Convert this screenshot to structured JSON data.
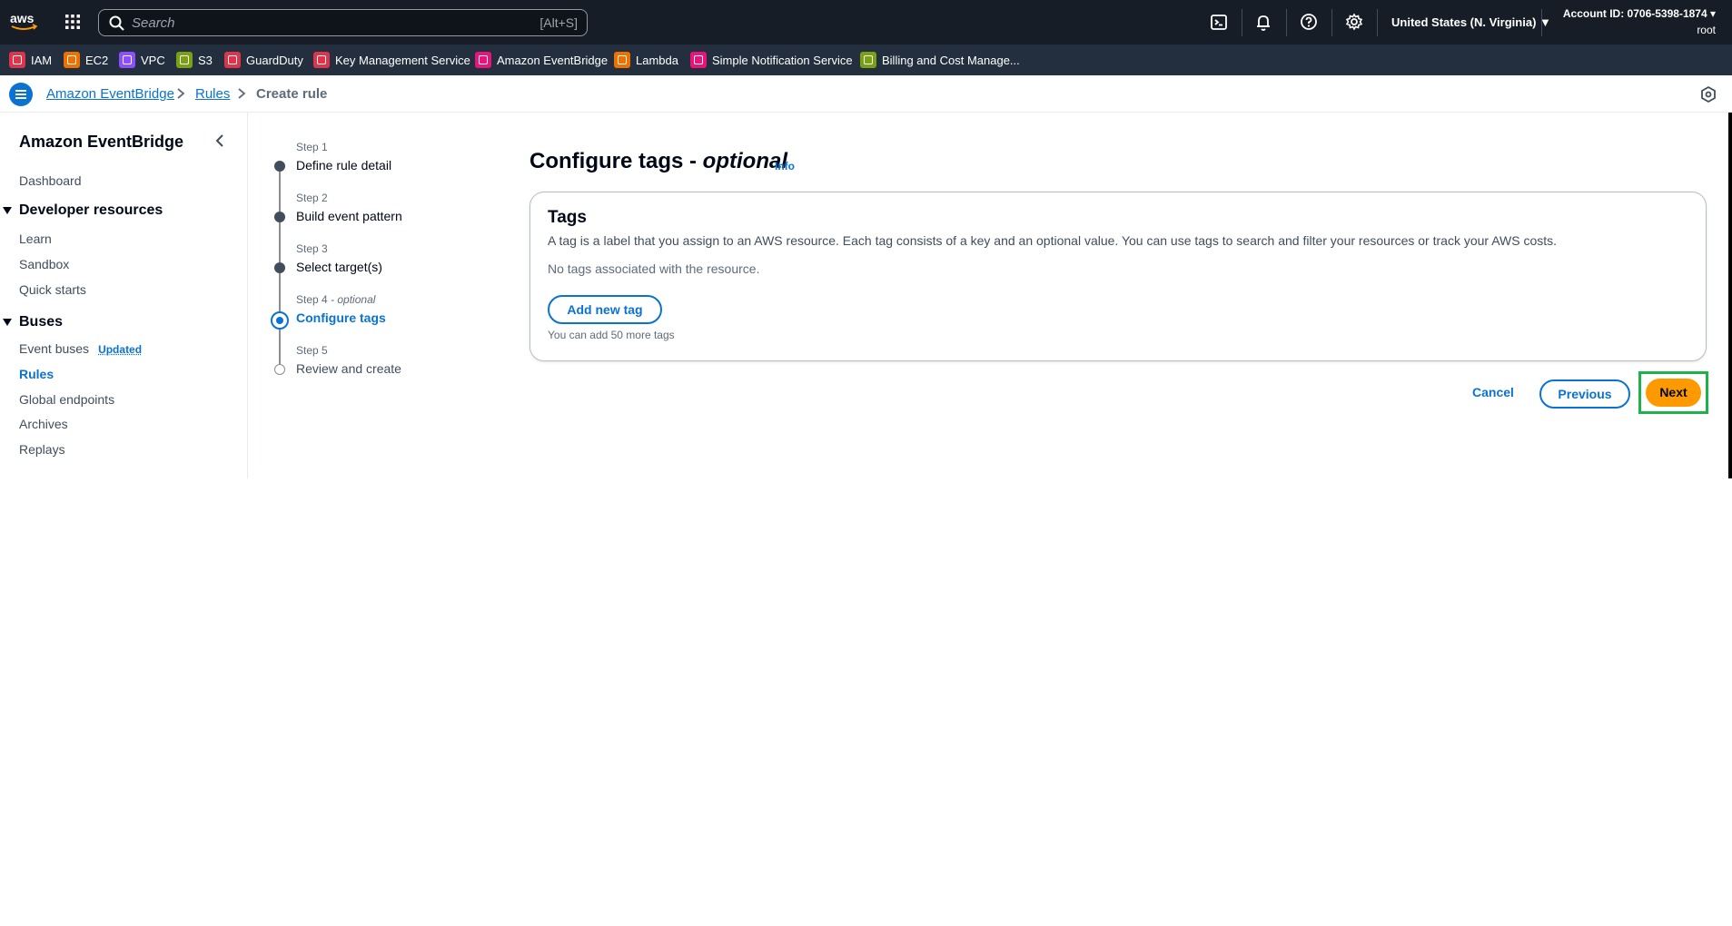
{
  "topnav": {
    "logo_text": "aws",
    "search": {
      "placeholder": "Search",
      "shortcut": "[Alt+S]"
    },
    "region": "United States (N. Virginia) ▼",
    "account_id": "Account ID: 0706-5398-1874 ▾",
    "user": "root",
    "icons": [
      "cloudshell-icon",
      "bell-icon",
      "help-icon",
      "gear-icon"
    ]
  },
  "favorites": [
    {
      "label": "IAM",
      "color": "#dd344c"
    },
    {
      "label": "EC2",
      "color": "#ed7100"
    },
    {
      "label": "VPC",
      "color": "#8c4fff"
    },
    {
      "label": "S3",
      "color": "#7aa116"
    },
    {
      "label": "GuardDuty",
      "color": "#dd344c"
    },
    {
      "label": "Key Management Service",
      "color": "#dd344c"
    },
    {
      "label": "Amazon EventBridge",
      "color": "#e7157b"
    },
    {
      "label": "Lambda",
      "color": "#ed7100"
    },
    {
      "label": "Simple Notification Service",
      "color": "#e7157b"
    },
    {
      "label": "Billing and Cost Manage...",
      "color": "#7aa116"
    }
  ],
  "breadcrumb": {
    "items": [
      "Amazon EventBridge",
      "Rules"
    ],
    "current": "Create rule"
  },
  "sidebar": {
    "title": "Amazon EventBridge",
    "dashboard": "Dashboard",
    "developer_section": "Developer resources",
    "developer_items": [
      "Learn",
      "Sandbox",
      "Quick starts"
    ],
    "buses_section": "Buses",
    "event_buses": "Event buses",
    "updated_badge": "Updated",
    "buses_items": [
      "Rules",
      "Global endpoints",
      "Archives",
      "Replays"
    ]
  },
  "steps": [
    {
      "label": "Step 1",
      "title": "Define rule detail",
      "state": "done"
    },
    {
      "label": "Step 2",
      "title": "Build event pattern",
      "state": "done"
    },
    {
      "label": "Step 3",
      "title": "Select target(s)",
      "state": "done"
    },
    {
      "label": "Step 4",
      "label_optional": "- optional",
      "title": "Configure tags",
      "state": "current"
    },
    {
      "label": "Step 5",
      "title": "Review and create",
      "state": "pending"
    }
  ],
  "main": {
    "title": "Configure tags -",
    "title_optional": "optional",
    "info": "Info",
    "tags": {
      "heading": "Tags",
      "description": "A tag is a label that you assign to an AWS resource. Each tag consists of a key and an optional value. You can use tags to search and filter your resources or track your AWS costs.",
      "empty": "No tags associated with the resource.",
      "add_button": "Add new tag",
      "hint": "You can add 50 more tags"
    },
    "buttons": {
      "cancel": "Cancel",
      "previous": "Previous",
      "next": "Next"
    }
  },
  "colors": {
    "primary_link": "#0972d3",
    "next_button": "#ff9900",
    "highlight_box": "#1db34a",
    "topnav_bg": "#161d26",
    "favbar_bg": "#232f3e"
  }
}
